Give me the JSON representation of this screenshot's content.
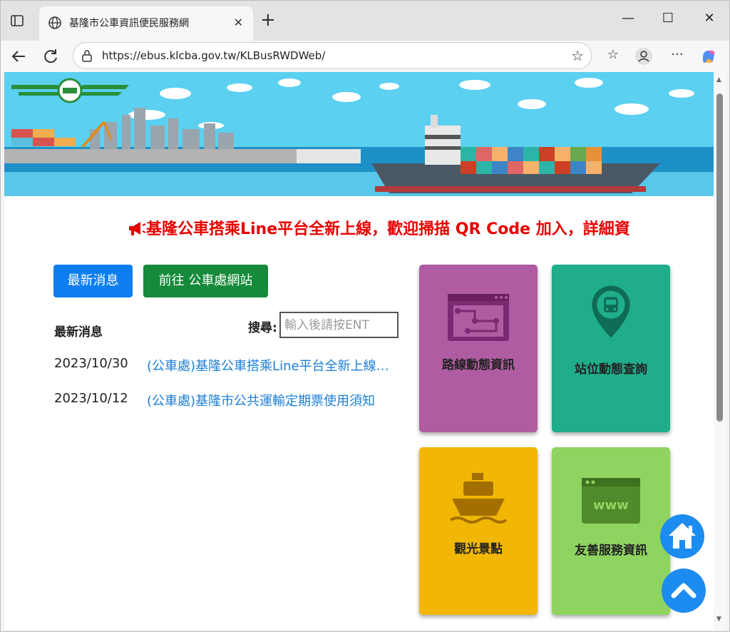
{
  "browser": {
    "tab_title": "基隆市公車資訊便民服務網",
    "tab_close": "✕",
    "new_tab": "+",
    "url": "https://ebus.klcba.gov.tw/KLBusRWDWeb/",
    "window_controls": {
      "minimize": "—",
      "maximize": "☐",
      "close": "✕"
    },
    "more": "···"
  },
  "page": {
    "marquee": "基隆公車搭乘Line平台全新上線，歡迎掃描 QR Code 加入，詳細資",
    "buttons": {
      "news": "最新消息",
      "goto": "前往 公車處網站"
    },
    "news_heading": "最新消息",
    "search": {
      "label": "搜尋:",
      "placeholder": "輸入後請按ENT"
    },
    "news": [
      {
        "date": "2023/10/30",
        "title": "(公車處)基隆公車搭乘Line平台全新上線，歡迎掃描QR Code加入"
      },
      {
        "date": "2023/10/12",
        "title": "(公車處)基隆市公共運輸定期票使用須知"
      }
    ],
    "tiles": [
      {
        "label": "路線動態資訊",
        "color": "#b05ca3",
        "icon": "route-map-icon"
      },
      {
        "label": "站位動態查詢",
        "color": "#1fad8a",
        "icon": "bus-stop-icon"
      },
      {
        "label": "觀光景點",
        "color": "#f2b705",
        "icon": "ship-icon"
      },
      {
        "label": "友善服務資訊",
        "color": "#8fd460",
        "icon": "website-icon"
      }
    ]
  },
  "colors": {
    "accent_blue": "#0d7ef0",
    "accent_green": "#158a3a",
    "marquee_red": "#e60000",
    "link": "#1c7ed6"
  }
}
